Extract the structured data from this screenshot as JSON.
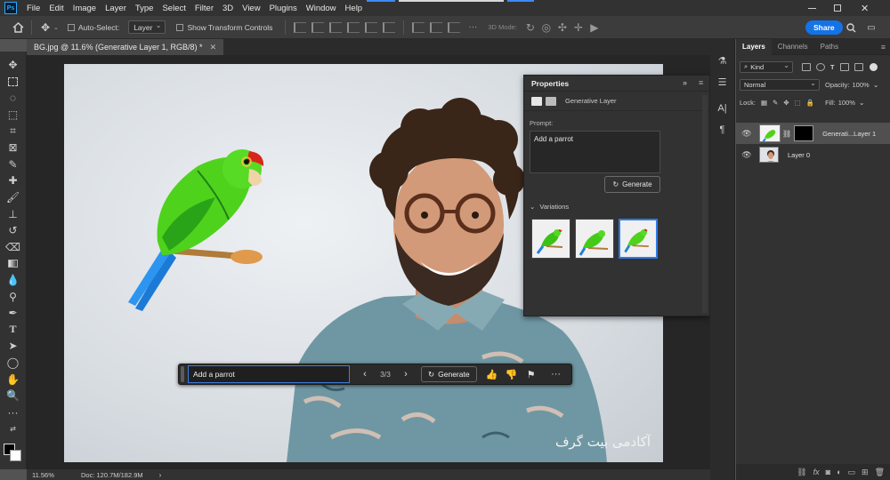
{
  "menu": {
    "logo": "Ps",
    "items": [
      "File",
      "Edit",
      "Image",
      "Layer",
      "Type",
      "Select",
      "Filter",
      "3D",
      "View",
      "Plugins",
      "Window",
      "Help"
    ]
  },
  "options": {
    "auto_select_label": "Auto-Select:",
    "auto_select_target": "Layer",
    "show_transform_label": "Show Transform Controls",
    "mode_3d_label": "3D Mode:",
    "share_label": "Share"
  },
  "document": {
    "tab_title": "BG.jpg @ 11.6% (Generative Layer 1, RGB/8) *",
    "watermark": "آکادمی بیت گرف"
  },
  "taskbar": {
    "prompt_value": "Add a parrot",
    "counter": "3/3",
    "generate_label": "Generate"
  },
  "status": {
    "zoom": "11.56%",
    "doc_info": "Doc: 120.7M/182.9M"
  },
  "properties": {
    "title": "Properties",
    "layer_type": "Generative Layer",
    "prompt_label": "Prompt:",
    "prompt_value": "Add a parrot",
    "generate_label": "Generate",
    "variations_label": "Variations",
    "selected_variation": 3
  },
  "layers": {
    "tabs": [
      "Layers",
      "Channels",
      "Paths"
    ],
    "filter_kind": "Kind",
    "blend_mode": "Normal",
    "opacity_label": "Opacity:",
    "opacity_value": "100%",
    "lock_label": "Lock:",
    "fill_label": "Fill:",
    "fill_value": "100%",
    "items": [
      {
        "name": "Generati...Layer 1",
        "selected": true
      },
      {
        "name": "Layer 0",
        "selected": false
      }
    ]
  },
  "colors": {
    "accent": "#1473e6",
    "selection": "#2d7be8",
    "panel": "#323232"
  }
}
